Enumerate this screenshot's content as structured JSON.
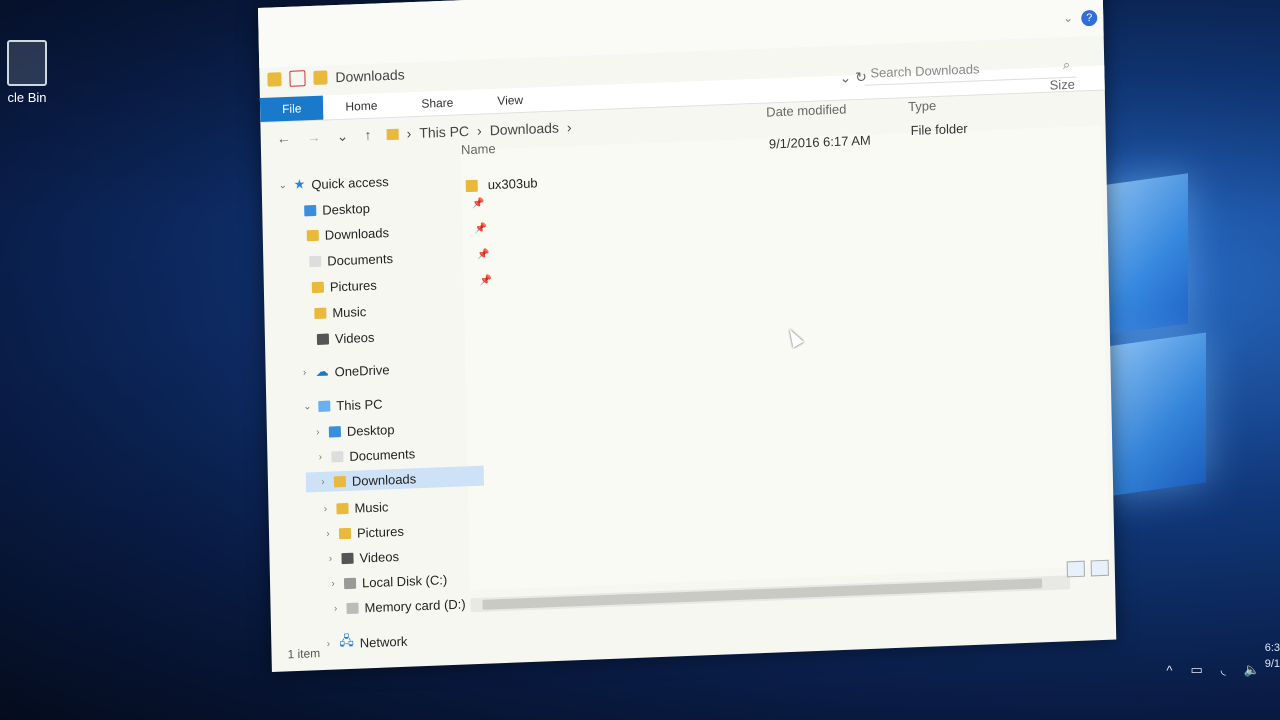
{
  "desktop": {
    "recycle_bin_label": "cle Bin"
  },
  "window": {
    "title": "Downloads",
    "controls": {
      "minimize": "—",
      "maximize": "☐",
      "close": "✕"
    },
    "help": "?",
    "ribbon_tabs": [
      "File",
      "Home",
      "Share",
      "View"
    ],
    "search_placeholder": "Search Downloads",
    "breadcrumb": [
      "This PC",
      "Downloads"
    ],
    "columns": {
      "name": "Name",
      "date": "Date modified",
      "type": "Type",
      "size": "Size"
    },
    "files": [
      {
        "name": "ux303ub",
        "date": "9/1/2016 6:17 AM",
        "type": "File folder"
      }
    ],
    "status": "1 item"
  },
  "sidebar": {
    "quick_access": "Quick access",
    "quick_items": [
      "Desktop",
      "Downloads",
      "Documents",
      "Pictures",
      "Music",
      "Videos"
    ],
    "onedrive": "OneDrive",
    "this_pc": "This PC",
    "pc_items": [
      "Desktop",
      "Documents",
      "Downloads",
      "Music",
      "Pictures",
      "Videos",
      "Local Disk (C:)",
      "Memory card (D:)"
    ],
    "network": "Network"
  },
  "taskbar": {
    "time": "6:3",
    "date": "9/1"
  },
  "colors": {
    "accent": "#1979ca",
    "selected": "#cde2f7",
    "folder": "#e8b93a"
  },
  "icons": [
    "recycle-bin-icon",
    "folder-icon",
    "pin-icon",
    "onedrive-icon",
    "this-pc-icon",
    "network-icon",
    "search-icon",
    "refresh-icon"
  ]
}
